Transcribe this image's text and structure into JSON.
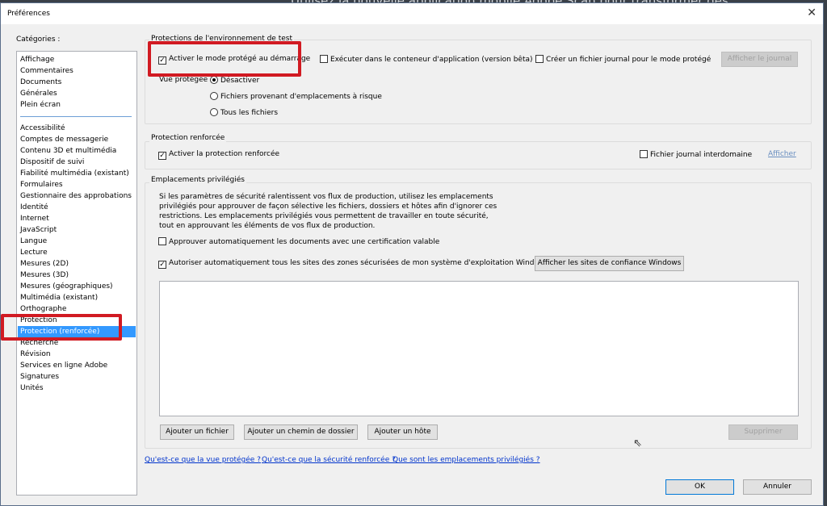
{
  "background_text": "Utilisez la nouvelle application mobile Adobe Scan pour transformer des",
  "window": {
    "title": "Préférences"
  },
  "categories": {
    "label": "Catégories :",
    "group1": [
      "Affichage",
      "Commentaires",
      "Documents",
      "Générales",
      "Plein écran"
    ],
    "group2": [
      "Accessibilité",
      "Comptes de messagerie",
      "Contenu 3D et multimédia",
      "Dispositif de suivi",
      "Fiabilité multimédia (existant)",
      "Formulaires",
      "Gestionnaire des approbations",
      "Identité",
      "Internet",
      "JavaScript",
      "Langue",
      "Lecture",
      "Mesures (2D)",
      "Mesures (3D)",
      "Mesures (géographiques)",
      "Multimédia (existant)",
      "Orthographe",
      "Protection",
      "Protection (renforcée)",
      "Recherche",
      "Révision",
      "Services en ligne Adobe",
      "Signatures",
      "Unités"
    ],
    "selected": "Protection (renforcée)"
  },
  "sandbox": {
    "title": "Protections de l'environnement de test",
    "protected_mode": "Activer le mode protégé au démarrage",
    "protected_mode_checked": true,
    "app_container": "Exécuter dans le conteneur d'application (version bêta)",
    "app_container_checked": false,
    "log": "Créer un fichier journal pour le mode protégé",
    "log_checked": false,
    "view_log": "Afficher le journal",
    "protected_view_label": "Vue protégée",
    "options": [
      "Désactiver",
      "Fichiers provenant d'emplacements à risque",
      "Tous les fichiers"
    ],
    "selected_option": "Désactiver"
  },
  "enhanced": {
    "title": "Protection renforcée",
    "enable": "Activer la protection renforcée",
    "enable_checked": true,
    "cross_domain": "Fichier journal interdomaine",
    "cross_domain_checked": false,
    "view": "Afficher"
  },
  "privileged": {
    "title": "Emplacements privilégiés",
    "description": [
      "Si les paramètres de sécurité ralentissent vos flux de production, utilisez les emplacements",
      "privilégiés pour approuver de façon sélective les fichiers, dossiers et hôtes afin d'ignorer ces",
      "restrictions. Les emplacements privilégiés vous permettent de travailler en toute sécurité,",
      "tout en approuvant les éléments de vos flux de production."
    ],
    "auto_cert": "Approuver automatiquement les documents avec une certification valable",
    "auto_cert_checked": false,
    "auto_sites": "Autoriser automatiquement tous les sites des zones sécurisées de mon système d'exploitation Windows",
    "auto_sites_checked": true,
    "show_sites": "Afficher les sites de confiance Windows",
    "add_file": "Ajouter un fichier",
    "add_folder": "Ajouter un chemin de dossier",
    "add_host": "Ajouter un hôte",
    "remove": "Supprimer"
  },
  "links": [
    "Qu'est-ce que la vue protégée ?",
    "Qu'est-ce que la sécurité renforcée ?",
    "Que sont les emplacements privilégiés ?"
  ],
  "footer": {
    "ok": "OK",
    "cancel": "Annuler"
  },
  "highlight_color": "#d11a22"
}
